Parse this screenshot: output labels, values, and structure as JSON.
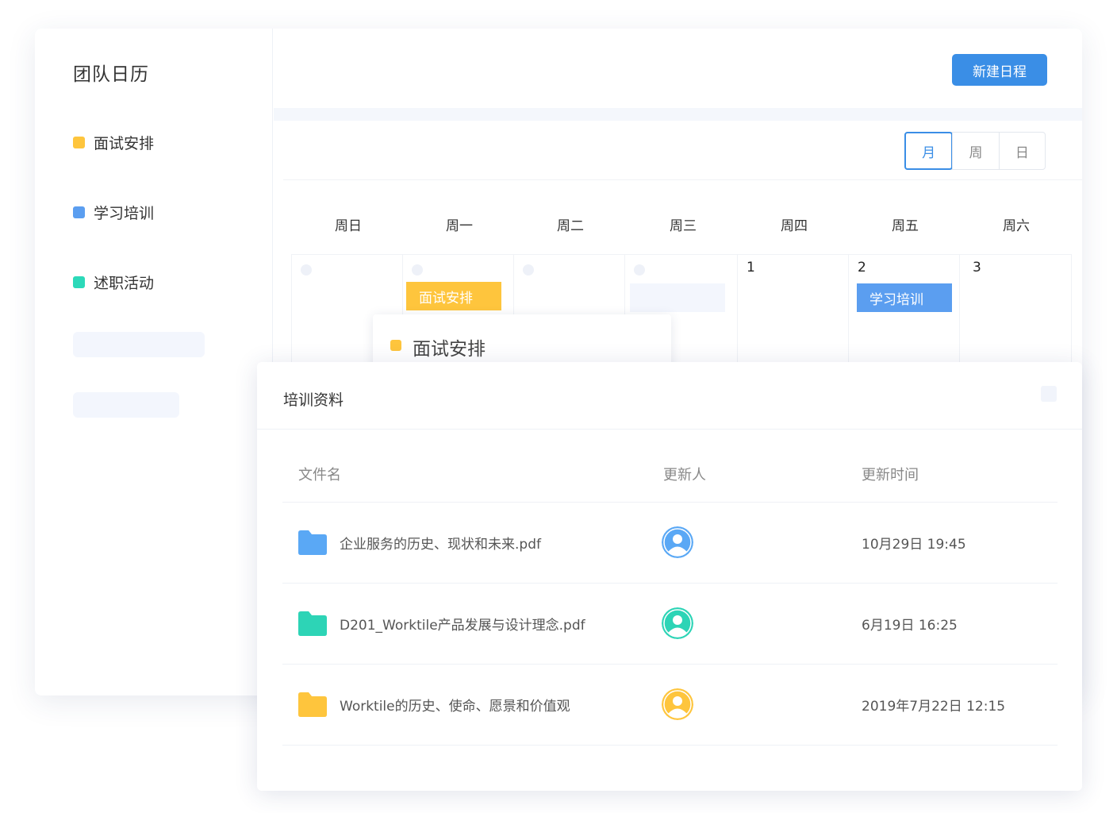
{
  "sidebar": {
    "title": "团队日历",
    "categories": [
      {
        "label": "面试安排",
        "color": "#fec53d"
      },
      {
        "label": "学习培训",
        "color": "#5b9ef0"
      },
      {
        "label": "述职活动",
        "color": "#2cd9b9"
      }
    ]
  },
  "toolbar": {
    "new_event_label": "新建日程"
  },
  "calendar": {
    "views": [
      "月",
      "周",
      "日"
    ],
    "active_view": "月",
    "weekdays": [
      "周日",
      "周一",
      "周二",
      "周三",
      "周四",
      "周五",
      "周六"
    ],
    "day_numbers": [
      "1",
      "2",
      "3"
    ],
    "events": [
      {
        "label": "面试安排",
        "color": "#fec53d"
      },
      {
        "label": "学习培训",
        "color": "#5b9ef0"
      }
    ],
    "popover": {
      "label": "面试安排",
      "color": "#fec53d"
    }
  },
  "panel": {
    "title": "培训资料",
    "columns": [
      "文件名",
      "更新人",
      "更新时间"
    ],
    "rows": [
      {
        "name": "企业服务的历史、现状和未来.pdf",
        "time": "10月29日  19:45",
        "folder_color": "#5aa8f5",
        "avatar_color": "#5aa8f5",
        "icon": "folder-icon"
      },
      {
        "name": "D201_Worktile产品发展与设计理念.pdf",
        "time": "6月19日   16:25",
        "folder_color": "#2dd4b6",
        "avatar_color": "#2dd4b6",
        "icon": "folder-icon"
      },
      {
        "name": "Worktile的历史、使命、愿景和价值观",
        "time": "2019年7月22日   12:15",
        "folder_color": "#fec53d",
        "avatar_color": "#fec53d",
        "icon": "folder-icon"
      }
    ]
  }
}
